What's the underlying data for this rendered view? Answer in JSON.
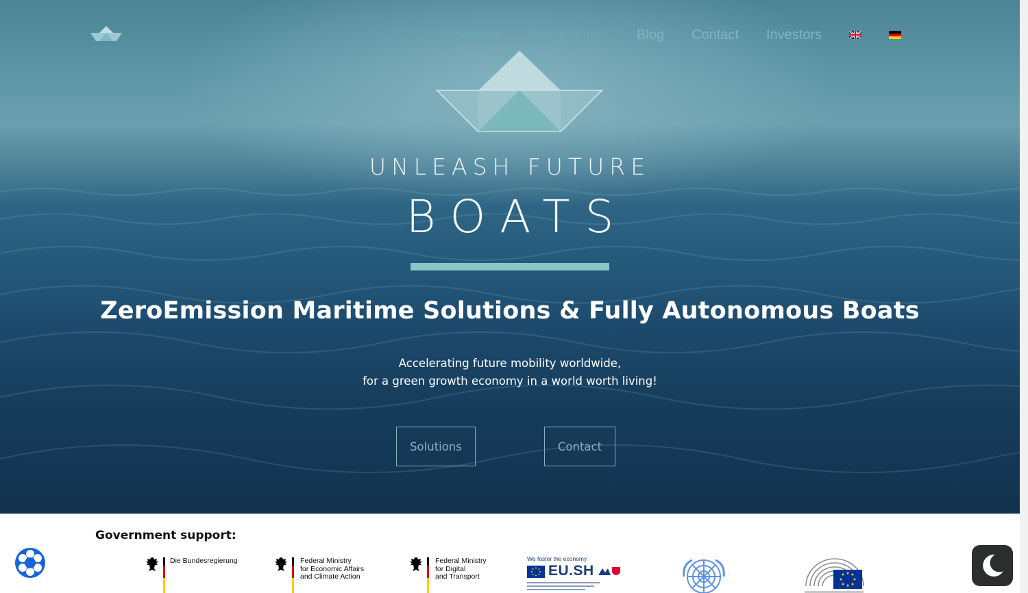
{
  "nav": {
    "items": [
      {
        "label": "Solutions"
      },
      {
        "label": "Management"
      },
      {
        "label": "Blog"
      },
      {
        "label": "Contact"
      },
      {
        "label": "Investors"
      }
    ],
    "languages": [
      {
        "icon": "flag-uk-icon"
      },
      {
        "icon": "flag-germany-icon"
      }
    ]
  },
  "hero": {
    "brand_line1": "UNLEASH FUTURE",
    "brand_line2": "BOATS",
    "headline": "ZeroEmission Maritime Solutions & Fully Autonomous Boats",
    "subline1": "Accelerating future mobility worldwide,",
    "subline2": "for a green growth economy in a world worth living!",
    "buttons": {
      "solutions": "Solutions",
      "contact": "Contact"
    }
  },
  "government": {
    "title": "Government support:",
    "logos": [
      {
        "lines": [
          "Die Bundesregierung"
        ]
      },
      {
        "lines": [
          "Federal Ministry",
          "for Economic Affairs",
          "and Climate Action"
        ]
      },
      {
        "lines": [
          "Federal Ministry",
          "for Digital",
          "and Transport"
        ]
      },
      {
        "caption": "We foster the economy",
        "mark": "EU.SH"
      },
      {
        "name": "United Nations"
      },
      {
        "name": "European Parliament"
      }
    ]
  },
  "colors": {
    "accent": "#7fb6c2",
    "divider": "#8ac8c8",
    "ocean_dark": "#12324f"
  },
  "icons": {
    "privacy": "privacy-settings-icon",
    "darkmode": "moon-icon"
  }
}
